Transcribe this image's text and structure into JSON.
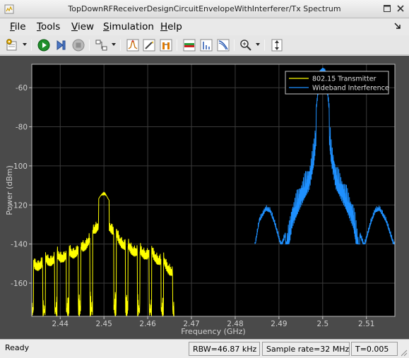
{
  "window": {
    "title": "TopDownRFReceiverDesignCircuitEnvelopeWithInterferer/Tx Spectrum"
  },
  "menu": [
    {
      "label": "File",
      "mnemonic": "F",
      "rest": "ile"
    },
    {
      "label": "Tools",
      "mnemonic": "T",
      "rest": "ools"
    },
    {
      "label": "View",
      "mnemonic": "V",
      "rest": "iew"
    },
    {
      "label": "Simulation",
      "mnemonic": "S",
      "rest": "imulation"
    },
    {
      "label": "Help",
      "mnemonic": "H",
      "rest": "elp"
    }
  ],
  "toolbar": {
    "icons": [
      "settings-icon",
      "run-icon",
      "step-forward-icon",
      "stop-icon",
      "highlight-block-icon",
      "peak-finder-icon",
      "edit-icon",
      "cursor-measurements-icon",
      "spectrum-icon",
      "distortion-icon",
      "ccdf-icon",
      "zoom-in-icon",
      "scale-axes-icon"
    ]
  },
  "chart_data": {
    "type": "line",
    "title": "",
    "xlabel": "Frequency (GHz)",
    "ylabel": "Power (dBm)",
    "xlim": [
      2.4335,
      2.5165
    ],
    "ylim": [
      -177,
      -48
    ],
    "x_ticks": [
      "2.44",
      "2.45",
      "2.46",
      "2.47",
      "2.48",
      "2.49",
      "2.5",
      "2.51"
    ],
    "x_tick_values": [
      2.44,
      2.45,
      2.46,
      2.47,
      2.48,
      2.49,
      2.5,
      2.51
    ],
    "y_ticks": [
      "-60",
      "-80",
      "-100",
      "-120",
      "-140",
      "-160"
    ],
    "y_tick_values": [
      -60,
      -80,
      -100,
      -120,
      -140,
      -160
    ],
    "grid": true,
    "legend_position": "top-right",
    "background": "#000000",
    "series": [
      {
        "name": "802.15 Transmitter",
        "color": "#ffff00",
        "x_range": [
          2.4335,
          2.466
        ],
        "center": 2.45,
        "peak_dbm": -113,
        "floor_dbm": -177,
        "envelope": [
          [
            2.4335,
            -140
          ],
          [
            2.436,
            -137
          ],
          [
            2.439,
            -135
          ],
          [
            2.442,
            -133
          ],
          [
            2.445,
            -130
          ],
          [
            2.447,
            -124
          ],
          [
            2.449,
            -116
          ],
          [
            2.45,
            -113
          ],
          [
            2.451,
            -117
          ],
          [
            2.453,
            -124
          ],
          [
            2.455,
            -129
          ],
          [
            2.458,
            -132
          ],
          [
            2.461,
            -133
          ],
          [
            2.464,
            -138
          ],
          [
            2.466,
            -143
          ]
        ]
      },
      {
        "name": "Wideband Interference",
        "color": "#1e90ff",
        "x_range": [
          2.4845,
          2.5165
        ],
        "center": 2.5,
        "peak_dbm": -49,
        "floor_dbm": -140,
        "envelope": [
          [
            2.4845,
            -139
          ],
          [
            2.4855,
            -126
          ],
          [
            2.487,
            -120
          ],
          [
            2.488,
            -121
          ],
          [
            2.489,
            -127
          ],
          [
            2.4905,
            -139
          ],
          [
            2.4915,
            -133
          ],
          [
            2.493,
            -112
          ],
          [
            2.495,
            -101
          ],
          [
            2.497,
            -92
          ],
          [
            2.498,
            -80
          ],
          [
            2.4988,
            -62
          ],
          [
            2.4994,
            -50
          ],
          [
            2.5,
            -49
          ],
          [
            2.5006,
            -50
          ],
          [
            2.5012,
            -62
          ],
          [
            2.502,
            -80
          ],
          [
            2.503,
            -92
          ],
          [
            2.505,
            -101
          ],
          [
            2.507,
            -112
          ],
          [
            2.5085,
            -133
          ],
          [
            2.5095,
            -139
          ],
          [
            2.511,
            -127
          ],
          [
            2.512,
            -121
          ],
          [
            2.513,
            -120
          ],
          [
            2.5145,
            -126
          ],
          [
            2.5165,
            -140
          ]
        ]
      }
    ]
  },
  "status": {
    "ready": "Ready",
    "rbw": "RBW=46.87 kHz",
    "sample_rate": "Sample rate=32 MHz",
    "time": "T=0.005"
  }
}
